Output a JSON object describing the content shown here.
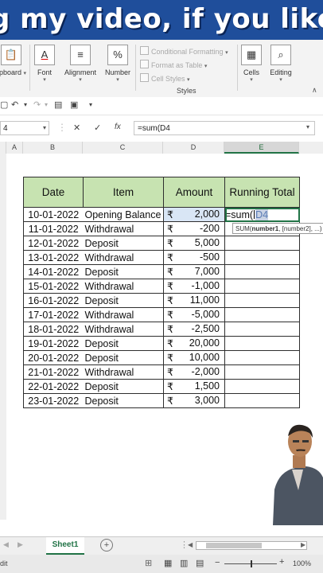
{
  "banner": {
    "text": "g my video, if you like"
  },
  "ribbon": {
    "clipboard_label": "lipboard",
    "font_label": "Font",
    "alignment_label": "Alignment",
    "number_label": "Number",
    "percent_symbol": "%",
    "conditional_formatting": "Conditional Formatting",
    "format_as_table": "Format as Table",
    "cell_styles": "Cell Styles",
    "styles_group": "Styles",
    "cells_label": "Cells",
    "editing_label": "Editing"
  },
  "formula_bar": {
    "name_box": "4",
    "cancel": "✕",
    "enter": "✓",
    "fx": "fx",
    "formula": "=sum(D4"
  },
  "columns": [
    "A",
    "B",
    "C",
    "D",
    "E"
  ],
  "table": {
    "headers": {
      "date": "Date",
      "item": "Item",
      "amount": "Amount",
      "running": "Running Total"
    },
    "currency": "₹",
    "rows": [
      {
        "date": "10-01-2022",
        "item": "Opening  Balance",
        "amount": "2,000"
      },
      {
        "date": "11-01-2022",
        "item": "Withdrawal",
        "amount": "-200"
      },
      {
        "date": "12-01-2022",
        "item": "Deposit",
        "amount": "5,000"
      },
      {
        "date": "13-01-2022",
        "item": "Withdrawal",
        "amount": "-500"
      },
      {
        "date": "14-01-2022",
        "item": "Deposit",
        "amount": "7,000"
      },
      {
        "date": "15-01-2022",
        "item": "Withdrawal",
        "amount": "-1,000"
      },
      {
        "date": "16-01-2022",
        "item": "Deposit",
        "amount": "11,000"
      },
      {
        "date": "17-01-2022",
        "item": "Withdrawal",
        "amount": "-5,000"
      },
      {
        "date": "18-01-2022",
        "item": "Withdrawal",
        "amount": "-2,500"
      },
      {
        "date": "19-01-2022",
        "item": "Deposit",
        "amount": "20,000"
      },
      {
        "date": "20-01-2022",
        "item": "Deposit",
        "amount": "10,000"
      },
      {
        "date": "21-01-2022",
        "item": "Withdrawal",
        "amount": "-2,000"
      },
      {
        "date": "22-01-2022",
        "item": "Deposit",
        "amount": "1,500"
      },
      {
        "date": "23-01-2022",
        "item": "Deposit",
        "amount": "3,000"
      }
    ],
    "active_cell_prefix": "=sum(",
    "active_cell_ref": "D4"
  },
  "tooltip": {
    "fn": "SUM(",
    "arg1": "number1",
    "rest": ", [number2], ...)"
  },
  "sheet_tab": "Sheet1",
  "add_sheet": "+",
  "status": {
    "left": "dit",
    "zoom": "100%"
  },
  "colors": {
    "header_fill": "#c7e3b1",
    "banner": "#1f4e9b",
    "excel_green": "#217346"
  }
}
